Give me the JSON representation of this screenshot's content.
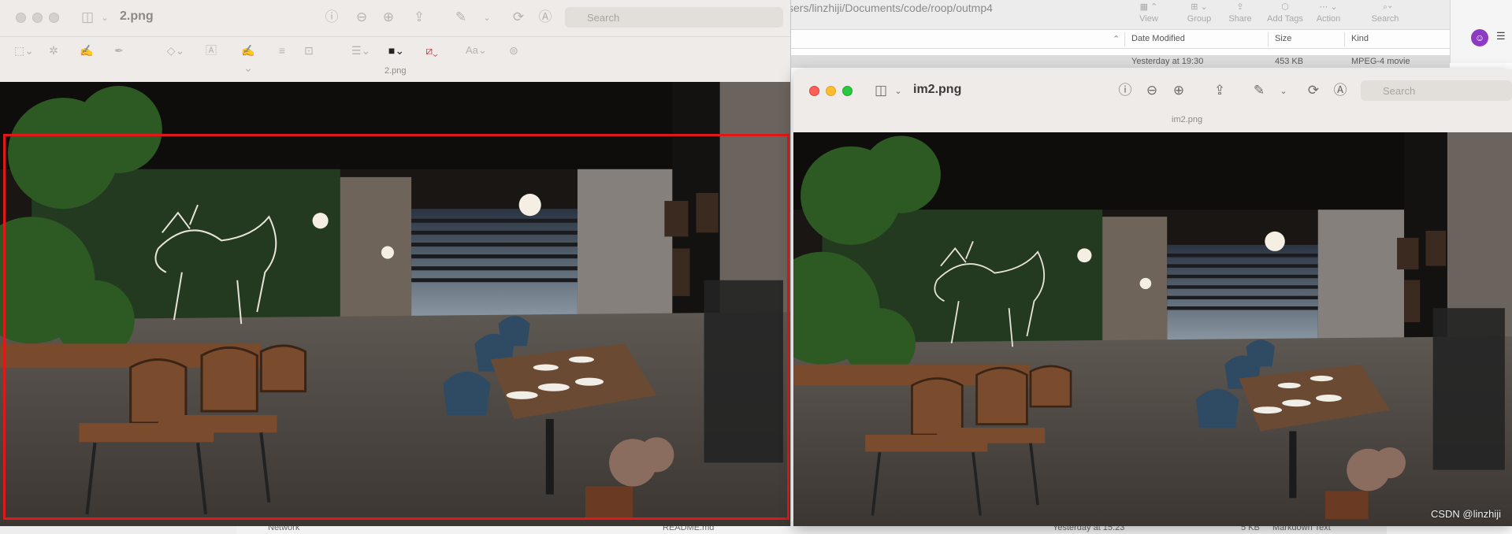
{
  "finder": {
    "path": "sers/linzhiji/Documents/code/roop/outmp4",
    "tools": [
      {
        "icon": "view-icon",
        "label": "View"
      },
      {
        "icon": "group-icon",
        "label": "Group"
      },
      {
        "icon": "share-icon",
        "label": "Share"
      },
      {
        "icon": "tag-icon",
        "label": "Add Tags"
      },
      {
        "icon": "action-icon",
        "label": "Action"
      },
      {
        "icon": "search-icon",
        "label": "Search"
      }
    ],
    "columns": {
      "date_modified": "Date Modified",
      "size": "Size",
      "kind": "Kind"
    },
    "selected_row": {
      "date": "Yesterday at 19:30",
      "size": "453 KB",
      "kind": "MPEG-4 movie"
    },
    "bottom_row": {
      "sidebar_item": "Network",
      "name": "README.md",
      "date": "Yesterday at 15:23",
      "size": "5 KB",
      "kind": "Markdown Text"
    }
  },
  "preview_left": {
    "title": "2.png",
    "doc_label": "2.png",
    "search_placeholder": "Search",
    "selection_color": "#e01818"
  },
  "preview_right": {
    "title": "im2.png",
    "doc_label": "im2.png",
    "search_placeholder": "Search"
  },
  "watermark": "CSDN @linzhiji",
  "colors": {
    "accent_red": "#e01818",
    "traffic_red": "#fe5f57",
    "traffic_yellow": "#febc2e",
    "traffic_green": "#28c840",
    "avatar": "#8e3bc4"
  }
}
